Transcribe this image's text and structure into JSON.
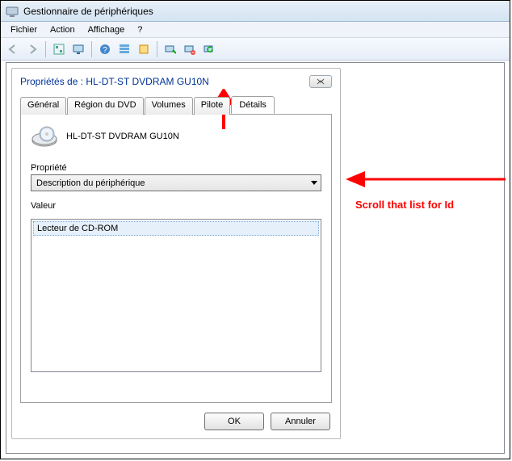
{
  "window": {
    "title": "Gestionnaire de périphériques"
  },
  "menu": {
    "items": [
      "Fichier",
      "Action",
      "Affichage",
      "?"
    ]
  },
  "toolbar_icons": [
    "back",
    "forward",
    "devtree",
    "monitor",
    "help",
    "view",
    "props",
    "scan",
    "uninstall",
    "update"
  ],
  "dialog": {
    "title": "Propriétés de : HL-DT-ST DVDRAM GU10N",
    "tabs": [
      "Général",
      "Région du DVD",
      "Volumes",
      "Pilote",
      "Détails"
    ],
    "active_tab": 4,
    "device_name": "HL-DT-ST DVDRAM GU10N",
    "property_label": "Propriété",
    "property_value": "Description du périphérique",
    "value_label": "Valeur",
    "value_item": "Lecteur de CD-ROM",
    "ok": "OK",
    "cancel": "Annuler"
  },
  "annotation": {
    "text": "Scroll that list for Id"
  }
}
